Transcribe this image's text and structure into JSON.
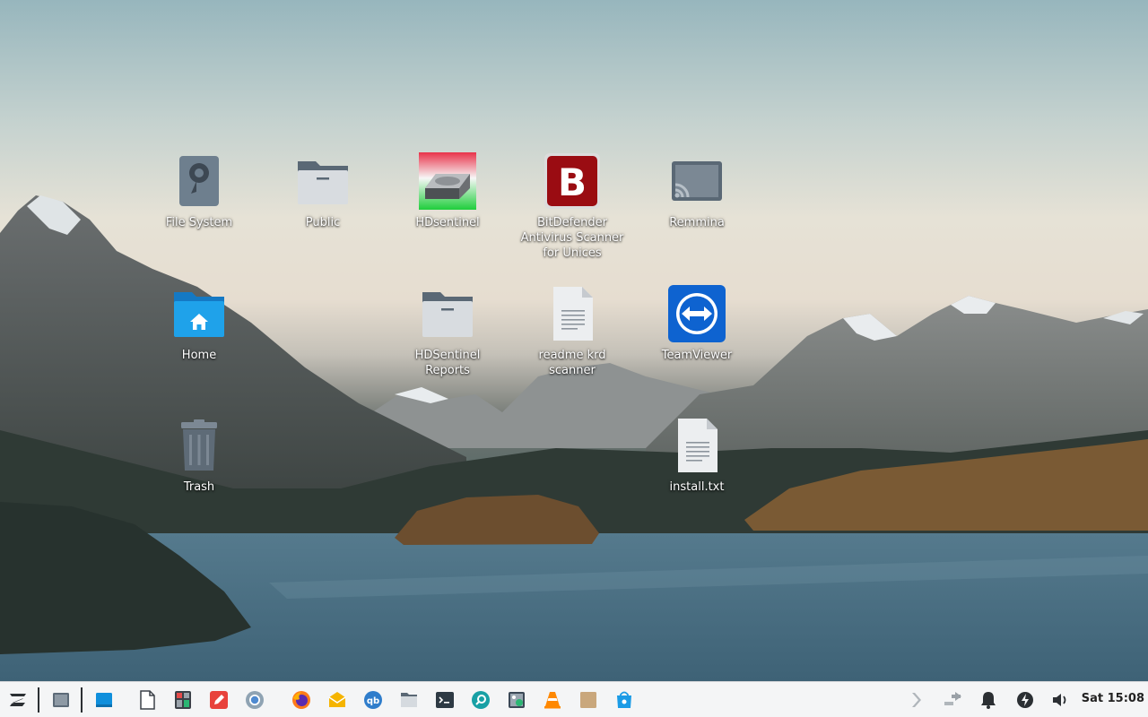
{
  "desktop": {
    "icons": [
      {
        "label": "File System",
        "icon": "drive-harddisk-icon"
      },
      {
        "label": "Public",
        "icon": "folder-icon"
      },
      {
        "label": "HDsentinel",
        "icon": "hdsentinel-icon"
      },
      {
        "label": "BitDefender Antivirus Scanner for Unices",
        "icon": "bitdefender-icon"
      },
      {
        "label": "Remmina",
        "icon": "remmina-icon"
      },
      {
        "label": "Home",
        "icon": "home-folder-icon"
      },
      {
        "label": "HDSentinel Reports",
        "icon": "folder-icon"
      },
      {
        "label": "readme krd scanner",
        "icon": "text-file-icon"
      },
      {
        "label": "TeamViewer",
        "icon": "teamviewer-icon"
      },
      {
        "label": "Trash",
        "icon": "trash-icon"
      },
      {
        "label": "install.txt",
        "icon": "text-file-icon"
      }
    ]
  },
  "taskbar": {
    "launchers": [
      "zorin-menu-icon",
      "show-desktop-icon",
      "active-window-icon",
      "text-editor-icon",
      "calculator-icon",
      "drawing-icon",
      "chromium-icon",
      "firefox-icon",
      "mail-icon",
      "qbittorrent-icon",
      "file-manager-icon",
      "terminal-icon",
      "search-tool-icon",
      "image-viewer-icon",
      "vlc-icon",
      "archive-icon",
      "software-store-icon"
    ],
    "tray": [
      "zorin-connect-icon",
      "network-icon",
      "notifications-icon",
      "power-icon",
      "volume-icon"
    ],
    "clock": "Sat 15:08"
  },
  "colors": {
    "taskbar_bg": "#f4f5f6",
    "folder_blue": "#1e9be6",
    "teamviewer_blue": "#0e63d0",
    "bitdefender_red": "#c1111a"
  }
}
